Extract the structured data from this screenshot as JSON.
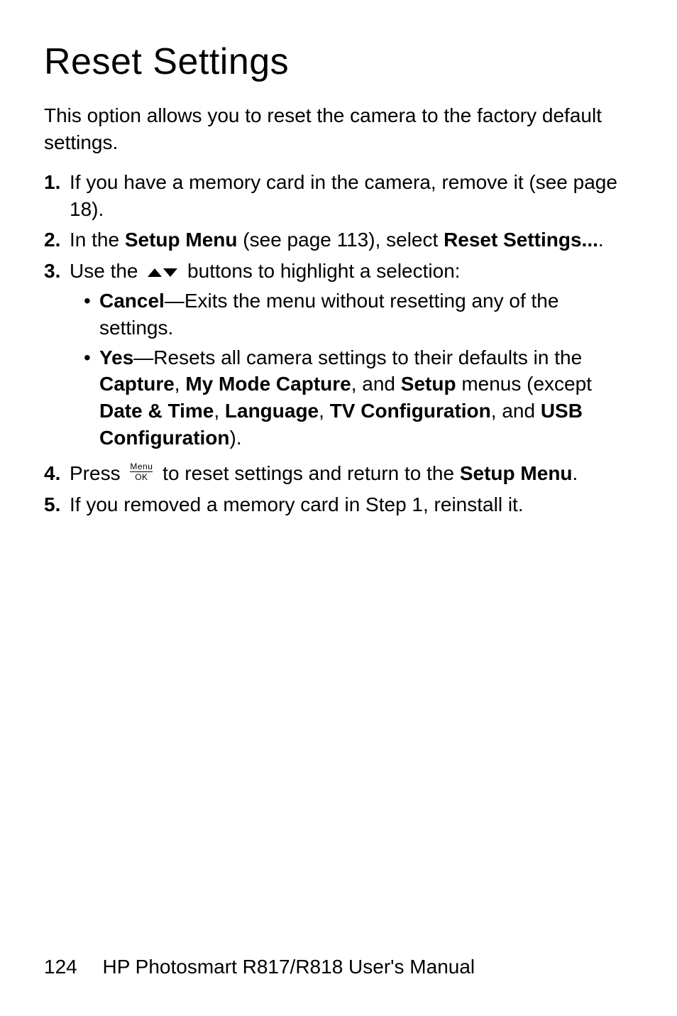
{
  "title": "Reset Settings",
  "intro": "This option allows you to reset the camera to the factory default settings.",
  "steps": {
    "1": {
      "text_a": "If you have a memory card in the camera, remove it (see page 18)."
    },
    "2": {
      "text_a": "In the ",
      "bold_a": "Setup Menu",
      "text_b": " (see page 113), select ",
      "bold_b": "Reset Settings...",
      "text_c": "."
    },
    "3": {
      "text_a": "Use the ",
      "text_b": " buttons to highlight a selection:",
      "bullets": {
        "cancel": {
          "bold": "Cancel",
          "text": "—Exits the menu without resetting any of the settings."
        },
        "yes": {
          "bold_a": "Yes",
          "text_a": "—Resets all camera settings to their defaults in the ",
          "bold_b": "Capture",
          "text_b": ", ",
          "bold_c": "My Mode Capture",
          "text_c": ", and ",
          "bold_d": "Setup",
          "text_d": " menus (except ",
          "bold_e": "Date & Time",
          "text_e": ", ",
          "bold_f": "Language",
          "text_f": ", ",
          "bold_g": "TV Configuration",
          "text_g": ", and ",
          "bold_h": "USB Configuration",
          "text_h": ")."
        }
      }
    },
    "4": {
      "text_a": "Press ",
      "text_b": " to reset settings and return to the ",
      "bold_a": "Setup Menu",
      "text_c": "."
    },
    "5": {
      "text_a": "If you removed a memory card in Step 1, reinstall it."
    }
  },
  "icons": {
    "menu_ok_top": "Menu",
    "menu_ok_bottom": "OK"
  },
  "footer": {
    "page": "124",
    "manual": "HP Photosmart R817/R818 User's Manual"
  }
}
